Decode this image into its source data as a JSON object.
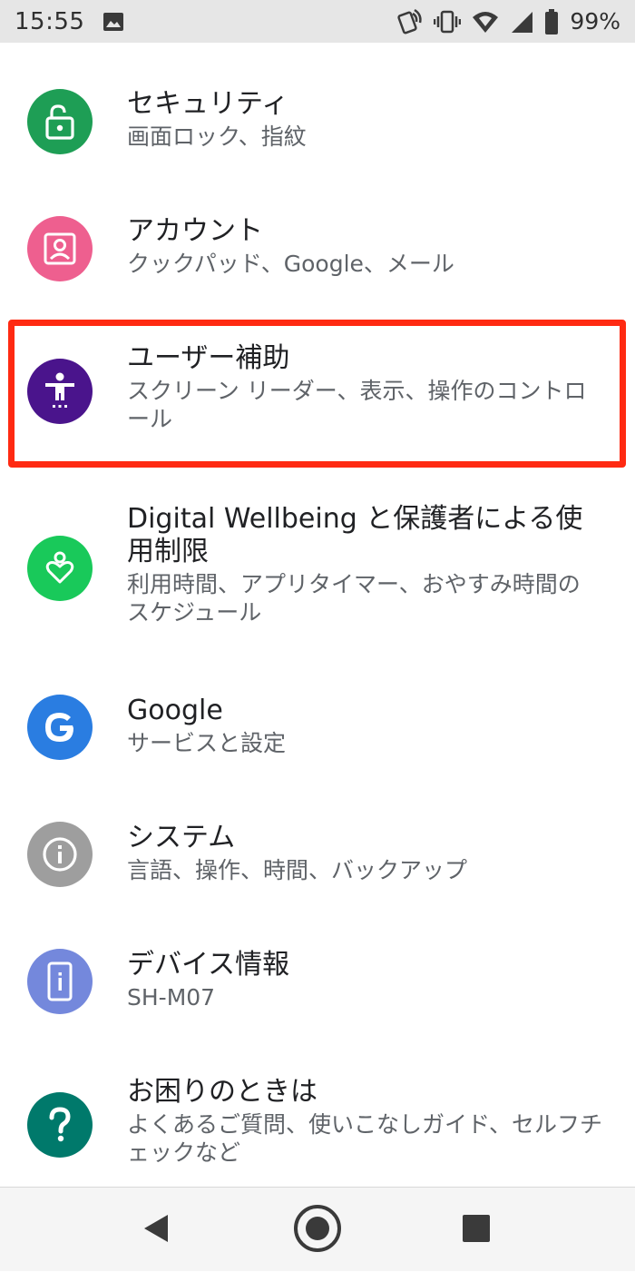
{
  "status_bar": {
    "time": "15:55",
    "battery_percent": "99%",
    "icons": [
      "image-notification-icon",
      "nfc-icon",
      "vibrate-icon",
      "wifi-icon",
      "cell-signal-icon",
      "battery-icon"
    ]
  },
  "settings": {
    "items": [
      {
        "title": "セキュリティ",
        "summary": "画面ロック、指紋",
        "icon": "lock-open-icon",
        "color": "#1e9e55"
      },
      {
        "title": "アカウント",
        "summary": "クックパッド、Google、メール",
        "icon": "account-box-icon",
        "color": "#ee5f8f"
      },
      {
        "title": "ユーザー補助",
        "summary": "スクリーン リーダー、表示、操作のコントロール",
        "icon": "accessibility-icon",
        "color": "#4a148c",
        "highlighted": true
      },
      {
        "title": "Digital Wellbeing と保護者による使用制限",
        "summary": "利用時間、アプリタイマー、おやすみ時間のスケジュール",
        "icon": "wellbeing-heart-icon",
        "color": "#19c95a"
      },
      {
        "title": "Google",
        "summary": "サービスと設定",
        "icon": "google-g-icon",
        "color": "#2a7de1"
      },
      {
        "title": "システム",
        "summary": "言語、操作、時間、バックアップ",
        "icon": "info-icon",
        "color": "#9e9e9e"
      },
      {
        "title": "デバイス情報",
        "summary": "SH-M07",
        "icon": "phone-info-icon",
        "color": "#7488dc"
      },
      {
        "title": "お困りのときは",
        "summary": "よくあるご質問、使いこなしガイド、セルフチェックなど",
        "icon": "help-icon",
        "color": "#00796b"
      }
    ]
  },
  "highlight_color": "#ff2a12",
  "nav": {
    "buttons": [
      "back-icon",
      "home-icon",
      "recents-icon"
    ]
  }
}
